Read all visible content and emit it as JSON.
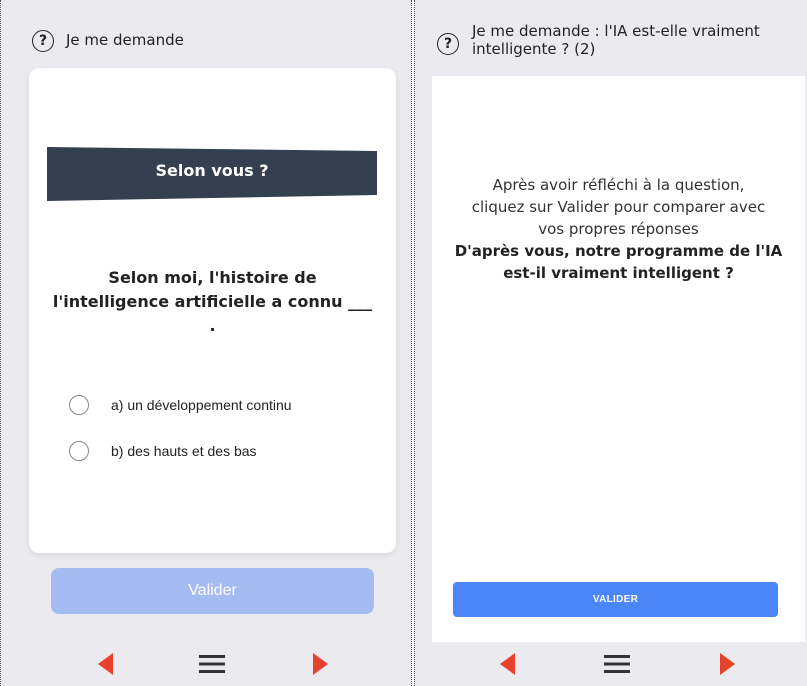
{
  "left_panel": {
    "top_bar": {
      "help_icon": "?",
      "title": "Je me demande"
    },
    "card": {
      "banner": "Selon vous ?",
      "question": "Selon moi, l'histoire de l'intelligence artificielle a connu ___ .",
      "options": [
        {
          "label": "a) un développement continu",
          "selected": false
        },
        {
          "label": "b) des hauts et des bas",
          "selected": false
        }
      ]
    },
    "validate_button": "Valider"
  },
  "right_panel": {
    "top_bar": {
      "help_icon": "?",
      "title": "Je me demande : l'IA est-elle vraiment intelligente ? (2)"
    },
    "card": {
      "instruction_lines": [
        "Après avoir réfléchi à la question,",
        "cliquez sur Valider pour comparer avec",
        "vos propres réponses"
      ],
      "question_lines": [
        "D'après vous, notre programme de l'IA",
        "est-il vraiment intelligent ?"
      ]
    },
    "validate_button": "VALIDER"
  },
  "colors": {
    "background": "#ebeaee",
    "banner": "#34404f",
    "accent_red": "#e8422d",
    "button_disabled": "#a4bcf1",
    "button_primary": "#4a86f7"
  },
  "icons": {
    "help": "question-circle-icon",
    "prev": "arrow-left-icon",
    "menu": "hamburger-menu-icon",
    "next": "arrow-right-icon"
  }
}
